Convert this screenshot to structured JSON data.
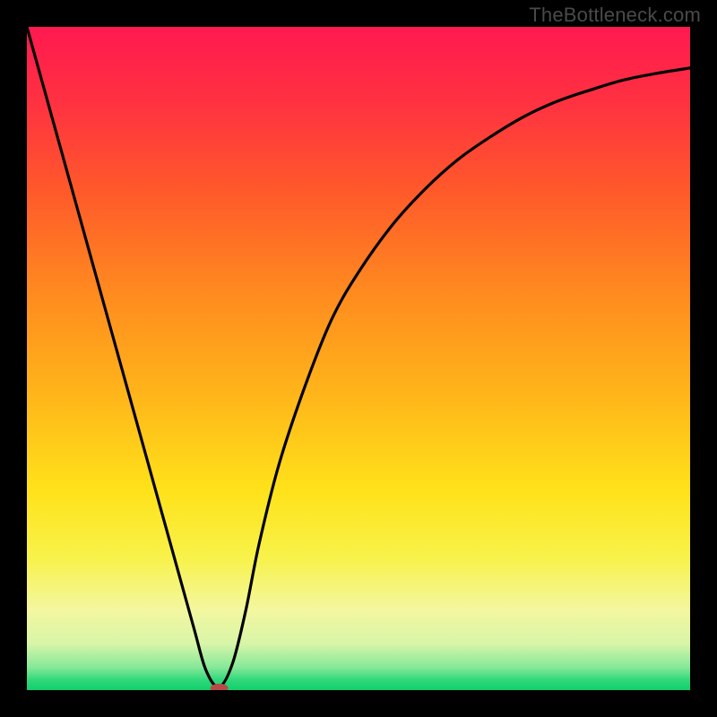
{
  "watermark": "TheBottleneck.com",
  "chart_data": {
    "type": "line",
    "title": "",
    "xlabel": "",
    "ylabel": "",
    "xlim": [
      0,
      100
    ],
    "ylim": [
      0,
      100
    ],
    "series": [
      {
        "name": "bottleneck-curve",
        "x": [
          0,
          5,
          10,
          15,
          20,
          25,
          27,
          29,
          31,
          33,
          35,
          38,
          42,
          46,
          50,
          55,
          60,
          65,
          70,
          75,
          80,
          85,
          90,
          95,
          100
        ],
        "y": [
          100,
          82,
          64,
          46,
          28,
          10,
          3,
          0.5,
          4,
          12,
          22,
          34,
          46,
          56,
          63,
          70,
          75.5,
          80,
          83.5,
          86.5,
          88.8,
          90.5,
          92,
          93,
          93.8
        ]
      }
    ],
    "marker": {
      "name": "minimum-point",
      "x": 29,
      "y": 0.3,
      "color": "#b84a4a",
      "rx": 10,
      "ry": 5
    },
    "background_gradient": {
      "stops": [
        {
          "offset": 0.0,
          "color": "#ff1950"
        },
        {
          "offset": 0.12,
          "color": "#ff3340"
        },
        {
          "offset": 0.25,
          "color": "#ff5a2a"
        },
        {
          "offset": 0.4,
          "color": "#ff8a1f"
        },
        {
          "offset": 0.55,
          "color": "#ffb41a"
        },
        {
          "offset": 0.7,
          "color": "#ffe21a"
        },
        {
          "offset": 0.8,
          "color": "#f8f24a"
        },
        {
          "offset": 0.88,
          "color": "#f3f7a0"
        },
        {
          "offset": 0.93,
          "color": "#d8f5a8"
        },
        {
          "offset": 0.965,
          "color": "#88e89a"
        },
        {
          "offset": 0.985,
          "color": "#2fd87a"
        },
        {
          "offset": 1.0,
          "color": "#12cf6d"
        }
      ]
    }
  }
}
